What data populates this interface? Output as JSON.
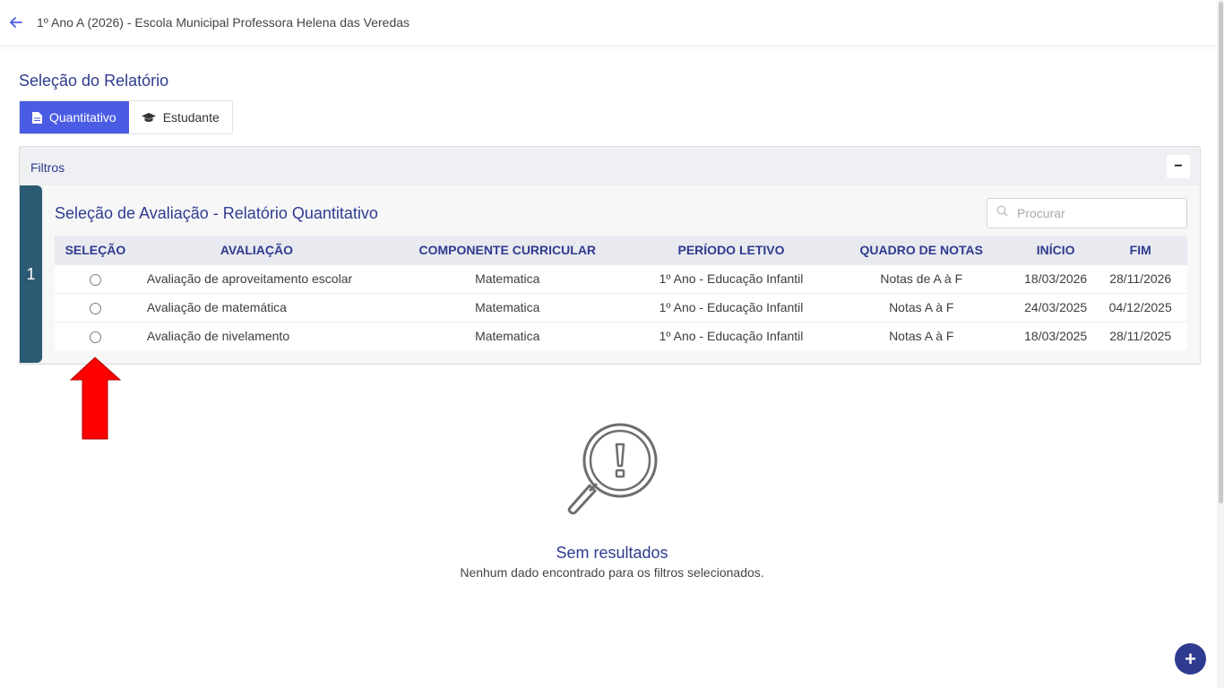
{
  "header": {
    "title": "1º Ano A (2026) - Escola Municipal Professora Helena das Veredas"
  },
  "report_selection": {
    "title": "Seleção do Relatório",
    "tabs": [
      {
        "label": "Quantitativo",
        "icon": "document-icon",
        "active": true
      },
      {
        "label": "Estudante",
        "icon": "graduation-cap-icon",
        "active": false
      }
    ]
  },
  "filters": {
    "title": "Filtros",
    "collapse_symbol": "−",
    "step_number": "1",
    "panel_title": "Seleção de Avaliação - Relatório Quantitativo",
    "search_placeholder": "Procurar",
    "table": {
      "columns": [
        "SELEÇÃO",
        "AVALIAÇÃO",
        "COMPONENTE CURRICULAR",
        "PERÍODO LETIVO",
        "QUADRO DE NOTAS",
        "INÍCIO",
        "FIM"
      ],
      "rows": [
        {
          "evaluation": "Avaliação de aproveitamento escolar",
          "component": "Matematica",
          "period": "1º Ano - Educação Infantil",
          "grades": "Notas de A à F",
          "start": "18/03/2026",
          "end": "28/11/2026"
        },
        {
          "evaluation": "Avaliação de matemática",
          "component": "Matematica",
          "period": "1º Ano - Educação Infantil",
          "grades": "Notas A à F",
          "start": "24/03/2025",
          "end": "04/12/2025"
        },
        {
          "evaluation": "Avaliação de nivelamento",
          "component": "Matematica",
          "period": "1º Ano - Educação Infantil",
          "grades": "Notas A à F",
          "start": "18/03/2025",
          "end": "28/11/2025"
        }
      ]
    }
  },
  "empty_state": {
    "title": "Sem resultados",
    "description": "Nenhum dado encontrado para os filtros selecionados."
  },
  "fab": {
    "symbol": "+"
  },
  "colors": {
    "primary": "#4b5ce4",
    "heading": "#2f3b8f",
    "step": "#2d5a73",
    "arrow": "#ff0000"
  }
}
